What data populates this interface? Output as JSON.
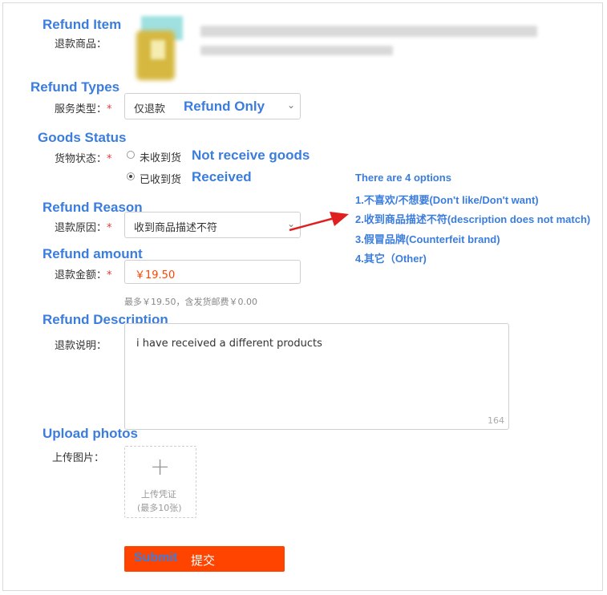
{
  "refund_item": {
    "en": "Refund Item",
    "label": "退款商品："
  },
  "refund_types": {
    "en": "Refund Types",
    "label": "服务类型：",
    "star": "*",
    "selected": "仅退款",
    "selected_en": "Refund Only"
  },
  "goods_status": {
    "en": "Goods Status",
    "label": "货物状态：",
    "star": "*",
    "option1": "未收到货",
    "option1_en": "Not receive goods",
    "option2": "已收到货",
    "option2_en": "Received",
    "selected_index": 2
  },
  "refund_reason": {
    "en": "Refund Reason",
    "label": "退款原因：",
    "star": "*",
    "selected": "收到商品描述不符"
  },
  "refund_amount": {
    "en": "Refund amount",
    "label": "退款金额：",
    "star": "*",
    "value": "￥19.50",
    "hint": "最多￥19.50，含发货邮费￥0.00"
  },
  "refund_description": {
    "en": "Refund Description",
    "label": "退款说明：",
    "value": "i have received a different products",
    "counter": "164"
  },
  "upload_photos": {
    "en": "Upload photos",
    "label": "上传图片：",
    "plus": "+",
    "line1": "上传凭证",
    "line2": "(最多10张)"
  },
  "submit": {
    "en": "Submit",
    "cn": "提交"
  },
  "annotation": {
    "title": "There are 4 options",
    "options": [
      "1.不喜欢/不想要(Don't like/Don't want)",
      "2.收到商品描述不符(description does not match)",
      "3.假冒品牌(Counterfeit brand)",
      "4.其它（Other)"
    ]
  },
  "colors": {
    "accent_blue": "#3b7ddd",
    "submit_orange": "#ff4400",
    "required_red": "#e4393c",
    "arrow_red": "#e02020"
  }
}
